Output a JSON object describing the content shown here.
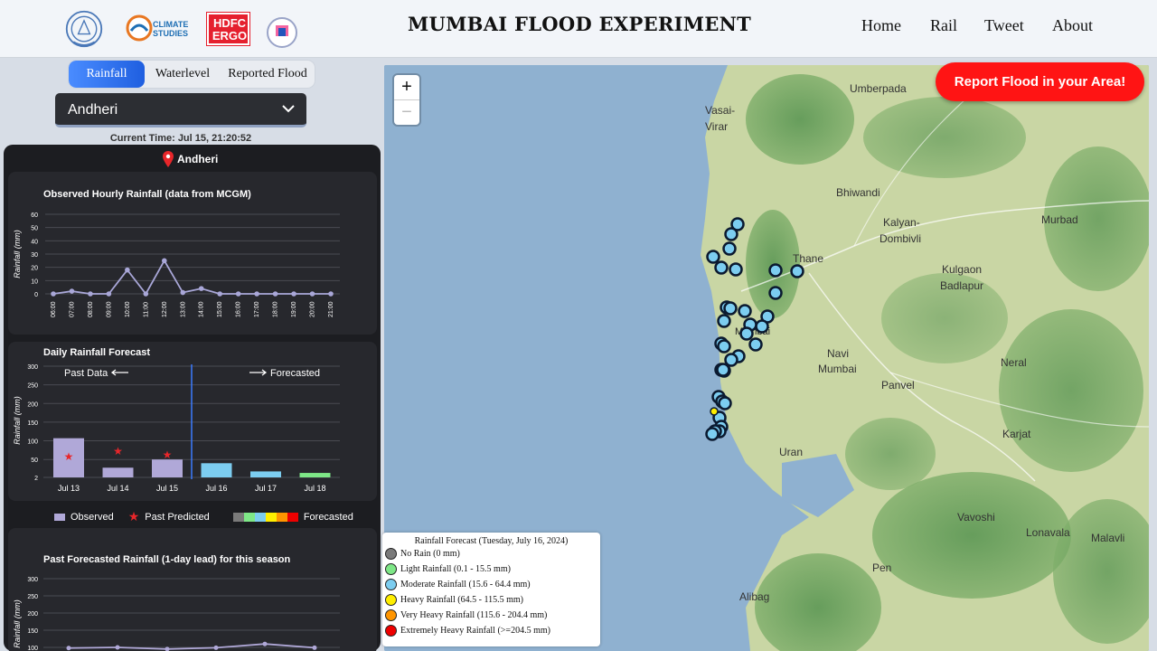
{
  "header": {
    "title": "MUMBAI FLOOD EXPERIMENT",
    "nav": [
      "Home",
      "Rail",
      "Tweet",
      "About"
    ],
    "logo2_text": "CLIMATE STUDIES",
    "logo3_text": "HDFC ERGO"
  },
  "tabs": [
    "Rainfall",
    "Waterlevel",
    "Reported Flood"
  ],
  "select": {
    "value": "Andheri"
  },
  "current_time": "Current Time: Jul 15, 21:20:52",
  "location": "Andheri",
  "hourly": {
    "title": "Observed Hourly Rainfall (data from MCGM)",
    "ylabel": "Rainfall (mm)"
  },
  "daily": {
    "title": "Daily Rainfall Forecast",
    "ylabel": "Rainfall (mm)",
    "past_label": "Past Data",
    "forecast_label": "Forecasted"
  },
  "legend": {
    "observed": "Observed",
    "past_predicted": "Past Predicted",
    "forecasted": "Forecasted"
  },
  "season": {
    "title": "Past Forecasted Rainfall (1-day lead) for this season",
    "ylabel": "Rainfall (mm)"
  },
  "map": {
    "report_button": "Report Flood in your Area!",
    "zoom_in": "+",
    "zoom_out": "−",
    "places": [
      "Umberpada",
      "Vasai-",
      "Virar",
      "Bhiwandi",
      "Kalyan-",
      "Dombivli",
      "Murbad",
      "Thane",
      "Kulgaon",
      "Badlapur",
      "Navi",
      "Mumbai",
      "Panvel",
      "Neral",
      "Karjat",
      "Uran",
      "Vavoshi",
      "Lonavala",
      "Malavli",
      "Pen",
      "Alibag",
      "Mumbai"
    ],
    "legend_title": "Rainfall Forecast (Tuesday, July 16, 2024)",
    "legend_items": [
      {
        "label": "No Rain (0 mm)",
        "color": "#7a7a7a"
      },
      {
        "label": "Light Rainfall (0.1 - 15.5 mm)",
        "color": "#7ee787"
      },
      {
        "label": "Moderate Rainfall (15.6 - 64.4 mm)",
        "color": "#7ccdf0"
      },
      {
        "label": "Heavy Rainfall (64.5 - 115.5 mm)",
        "color": "#ffee00"
      },
      {
        "label": "Very Heavy Rainfall (115.6 - 204.4 mm)",
        "color": "#ff9500"
      },
      {
        "label": "Extremely Heavy Rainfall (>=204.5 mm)",
        "color": "#ee0000"
      }
    ]
  },
  "chart_data": [
    {
      "type": "line",
      "title": "Observed Hourly Rainfall (data from MCGM)",
      "ylabel": "Rainfall (mm)",
      "ylim": [
        0,
        60
      ],
      "yticks": [
        0,
        10,
        20,
        30,
        40,
        50,
        60
      ],
      "categories": [
        "06:00",
        "07:00",
        "08:00",
        "09:00",
        "10:00",
        "11:00",
        "12:00",
        "13:00",
        "14:00",
        "15:00",
        "16:00",
        "17:00",
        "18:00",
        "19:00",
        "20:00",
        "21:00"
      ],
      "values": [
        0,
        2,
        0,
        0,
        18,
        0,
        25,
        1,
        4,
        0,
        0,
        0,
        0,
        0,
        0,
        0
      ],
      "color": "#a9a7d8"
    },
    {
      "type": "bar",
      "title": "Daily Rainfall Forecast",
      "ylabel": "Rainfall (mm)",
      "ylim": [
        2,
        300
      ],
      "yticks": [
        2,
        50,
        100,
        150,
        200,
        250,
        300
      ],
      "categories": [
        "Jul 13",
        "Jul 14",
        "Jul 15",
        "Jul 16",
        "Jul 17",
        "Jul 18"
      ],
      "observed": [
        107,
        28,
        50,
        null,
        null,
        null
      ],
      "past_predicted": [
        58,
        72,
        62,
        null,
        null,
        null
      ],
      "forecasted": [
        null,
        null,
        null,
        40,
        18,
        14
      ],
      "forecast_colors": [
        "#7ccdf0",
        "#7ccdf0",
        "#7ee787"
      ],
      "observed_color": "#b0a8d8"
    },
    {
      "type": "line",
      "title": "Past Forecasted Rainfall (1-day lead) for this season",
      "ylabel": "Rainfall (mm)",
      "ylim": [
        100,
        300
      ],
      "yticks": [
        100,
        150,
        200,
        250,
        300
      ],
      "values": [
        98,
        100,
        95,
        99,
        110,
        99
      ],
      "color": "#b0a8d8"
    }
  ]
}
